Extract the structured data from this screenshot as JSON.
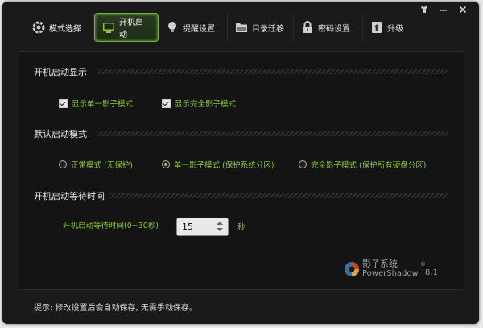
{
  "titlebar": {
    "icons": [
      "shirt-icon",
      "minimize-icon",
      "close-icon"
    ]
  },
  "tabs": [
    {
      "label": "模式选择",
      "icon": "gear-icon",
      "active": false
    },
    {
      "label": "开机启动",
      "icon": "monitor-icon",
      "active": true
    },
    {
      "label": "提醒设置",
      "icon": "bulb-icon",
      "active": false
    },
    {
      "label": "目录迁移",
      "icon": "folder-icon",
      "active": false
    },
    {
      "label": "密码设置",
      "icon": "lock-icon",
      "active": false
    },
    {
      "label": "升级",
      "icon": "upgrade-icon",
      "active": false
    }
  ],
  "display": {
    "title": "开机启动显示",
    "options": [
      {
        "label": "显示单一影子模式",
        "checked": true
      },
      {
        "label": "显示完全影子模式",
        "checked": true
      }
    ]
  },
  "default_mode": {
    "title": "默认启动模式",
    "options": [
      {
        "label": "正常模式 (无保护)",
        "selected": false
      },
      {
        "label": "单一影子模式 (保护系统分区)",
        "selected": true
      },
      {
        "label": "完全影子模式 (保护所有硬盘分区)",
        "selected": false
      }
    ]
  },
  "wait": {
    "title": "开机启动等待时间",
    "label": "开机启动等待时间(0~30秒)",
    "value": "15",
    "unit": "秒"
  },
  "logo": {
    "cn": "影子系统",
    "en": "PowerShadow",
    "reg": "®",
    "version": "8.1"
  },
  "tip": "提示: 修改设置后会自动保存, 无需手动保存。",
  "colors": {
    "accent": "#8dc63f",
    "active_border": "#6fb43a",
    "bg": "#1a1a1a"
  }
}
